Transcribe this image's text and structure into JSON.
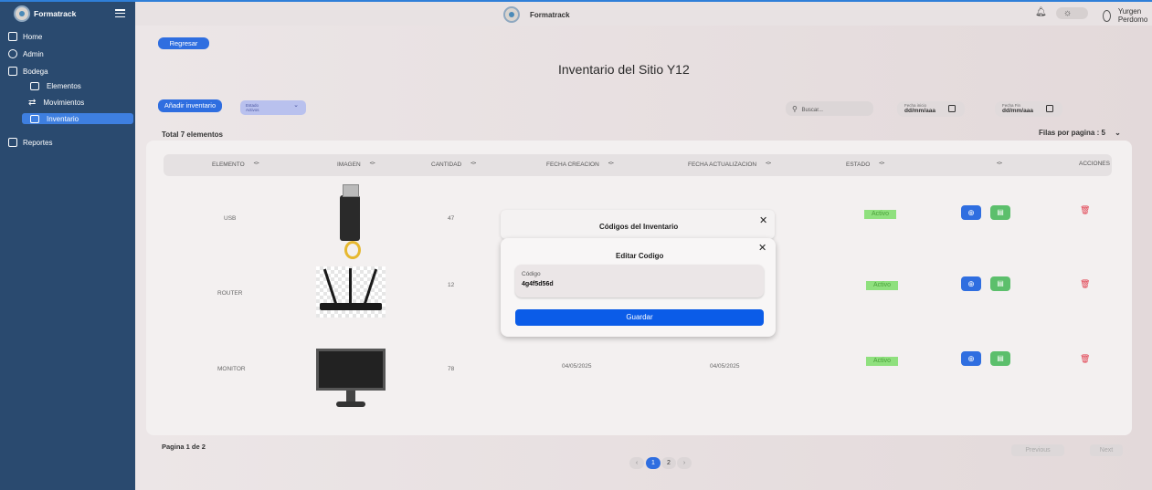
{
  "sidebar": {
    "brand": "Formatrack",
    "items": [
      {
        "label": "Home",
        "icon": "home-icon"
      },
      {
        "label": "Admin",
        "icon": "user-icon"
      },
      {
        "label": "Bodega",
        "icon": "warehouse-icon"
      }
    ],
    "subitems": [
      {
        "label": "Elementos",
        "icon": "cube-icon"
      },
      {
        "label": "Movimientos",
        "icon": "arrows-icon"
      },
      {
        "label": "Inventario",
        "icon": "inventory-icon",
        "active": true
      }
    ],
    "reportes": "Reportes"
  },
  "header": {
    "brand": "Formatrack",
    "user": "Yurgen Perdomo"
  },
  "main": {
    "back": "Regresar",
    "title": "Inventario del Sitio Y12",
    "add": "Añadir inventario",
    "estado_label": "Estado",
    "estado_value": "Activos",
    "search_placeholder": "Buscar...",
    "fecha_inicio_label": "Fecha inicio",
    "fecha_fin_label": "Fecha Fin",
    "date_placeholder": "dd/mm/aaa",
    "total": "Total 7 elementos",
    "filas": "Filas por pagina : 5"
  },
  "table": {
    "headers": [
      "ELEMENTO",
      "IMAGEN",
      "CANTIDAD",
      "FECHA CREACION",
      "FECHA ACTUALIZACION",
      "ESTADO",
      "",
      "ACCIONES"
    ],
    "rows": [
      {
        "elemento": "USB",
        "cantidad": "47",
        "creacion": "",
        "actualizacion": "",
        "estado": "Activo"
      },
      {
        "elemento": "ROUTER",
        "cantidad": "12",
        "creacion": "",
        "actualizacion": "",
        "estado": "Activo"
      },
      {
        "elemento": "MONITOR",
        "cantidad": "78",
        "creacion": "04/05/2025",
        "actualizacion": "04/05/2025",
        "estado": "Activo"
      }
    ]
  },
  "modal_outer": {
    "title": "Códigos del Inventario"
  },
  "modal_inner": {
    "title": "Editar Codigo",
    "field_label": "Código",
    "field_value": "4g4f5d56d",
    "save": "Guardar"
  },
  "pagination": {
    "info": "Pagina 1 de 2",
    "prev_arrow": "‹",
    "next_arrow": "›",
    "pages": [
      "1",
      "2"
    ],
    "previous": "Previous",
    "next": "Next"
  },
  "colors": {
    "sidebar": "#2a4a6f",
    "accent": "#2f6ee0",
    "active_badge": "#8fe07e",
    "save_button": "#0b5ce8"
  }
}
